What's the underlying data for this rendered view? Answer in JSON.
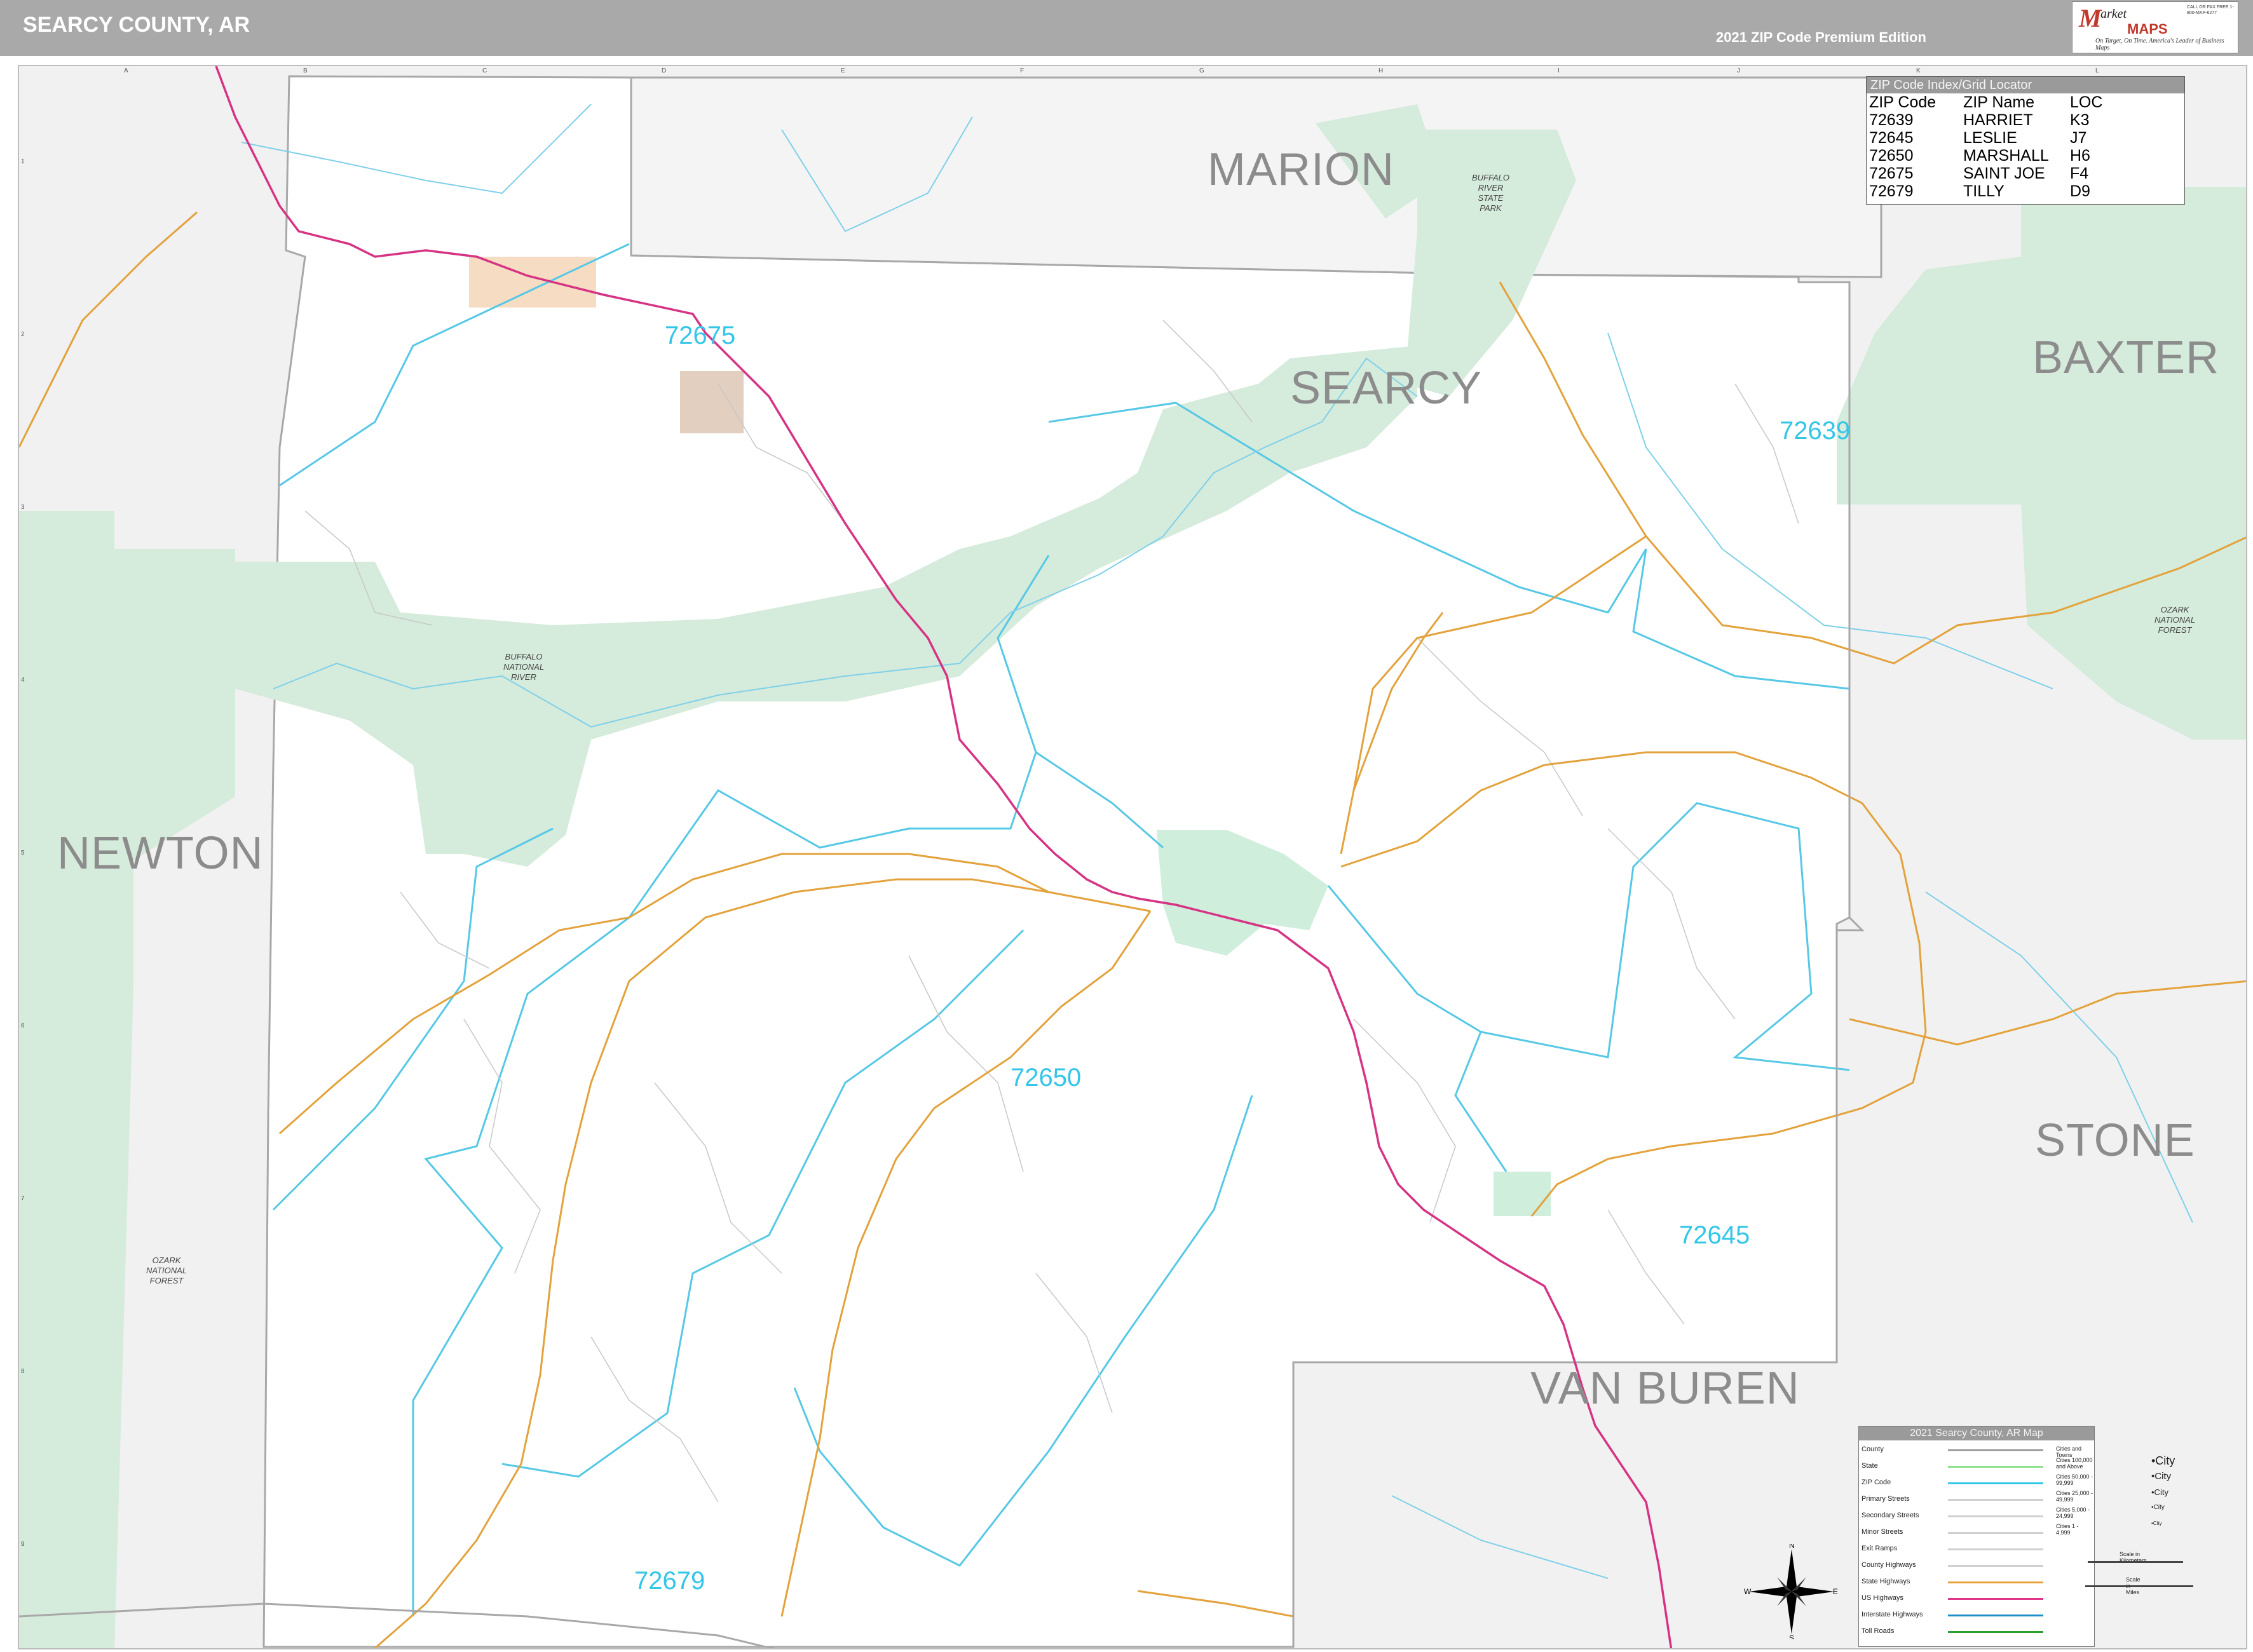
{
  "header": {
    "title": "SEARCY COUNTY, AR",
    "edition": "2021 ZIP Code Premium Edition",
    "logo": {
      "brand_top": "M",
      "brand_word": "arket",
      "brand_maps": "MAPS",
      "tagline": "On Target, On Time. America's Leader of Business Maps",
      "contact": "CALL OR FAX FREE 1-800-MAP-6277"
    }
  },
  "grid": {
    "columns": [
      "A",
      "B",
      "C",
      "D",
      "E",
      "F",
      "G",
      "H",
      "I",
      "J",
      "K",
      "L"
    ],
    "rows": [
      "1",
      "2",
      "3",
      "4",
      "5",
      "6",
      "7",
      "8",
      "9"
    ]
  },
  "counties": {
    "center": "SEARCY",
    "marion": "MARION",
    "baxter": "BAXTER",
    "newton": "NEWTON",
    "stone": "STONE",
    "van_buren": "VAN BUREN"
  },
  "zip_labels": {
    "z72675": "72675",
    "z72639": "72639",
    "z72650": "72650",
    "z72645": "72645",
    "z72679": "72679"
  },
  "forests": {
    "buffalo_state_park": [
      "BUFFALO",
      "RIVER",
      "STATE",
      "PARK"
    ],
    "buffalo_national_river": [
      "BUFFALO",
      "NATIONAL",
      "RIVER"
    ],
    "ozark_west": [
      "OZARK",
      "NATIONAL",
      "FOREST"
    ],
    "ozark_east": [
      "OZARK",
      "NATIONAL",
      "FOREST"
    ]
  },
  "zip_index": {
    "title": "ZIP Code Index/Grid Locator",
    "columns": [
      "ZIP Code",
      "ZIP Name",
      "LOC"
    ],
    "rows": [
      [
        "72639",
        "HARRIET",
        "K3"
      ],
      [
        "72645",
        "LESLIE",
        "J7"
      ],
      [
        "72650",
        "MARSHALL",
        "H6"
      ],
      [
        "72675",
        "SAINT JOE",
        "F4"
      ],
      [
        "72679",
        "TILLY",
        "D9"
      ]
    ]
  },
  "legend": {
    "title": "2021 Searcy County, AR Map",
    "left_items": [
      "County",
      "State",
      "ZIP Code",
      "Primary Streets",
      "Secondary Streets",
      "Minor Streets",
      "Exit Ramps",
      "County Highways",
      "State Highways",
      "US Highways",
      "Interstate Highways",
      "Toll Roads"
    ],
    "cities_title": "Cities and Towns",
    "city_items": [
      {
        "range": "Cities 100,000 and Above",
        "sample": "City"
      },
      {
        "range": "Cities 50,000 - 99,999",
        "sample": "City"
      },
      {
        "range": "Cities 25,000 - 49,999",
        "sample": "City"
      },
      {
        "range": "Cities 5,000 - 24,999",
        "sample": "City"
      },
      {
        "range": "Cities 1 - 4,999",
        "sample": "City"
      }
    ],
    "scale_km": "Scale in Kilometers",
    "scale_miles": "Scale in Miles",
    "colors": {
      "county": "#9e9e9e",
      "state": "#8be08b",
      "zip": "#33c6e8",
      "state_highways": "#e8a33c",
      "us_highways": "#e0368a",
      "interstate": "#1f8fc7",
      "toll": "#2e9e2e"
    }
  },
  "compass": {
    "n": "N",
    "s": "S",
    "e": "E",
    "w": "W"
  }
}
